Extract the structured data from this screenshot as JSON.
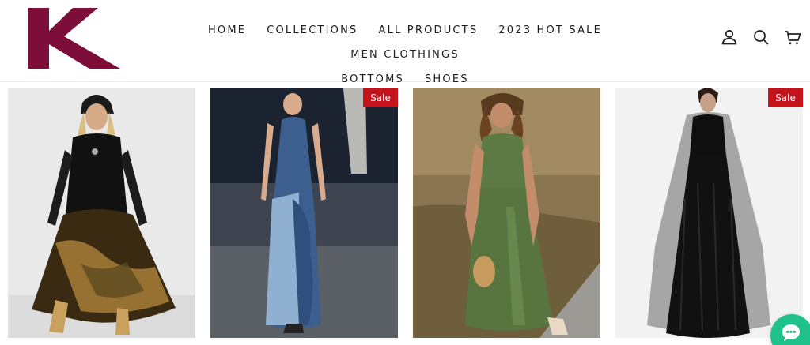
{
  "brand": {
    "logo_letter": "K",
    "logo_color": "#7d0e3a"
  },
  "nav": {
    "items": [
      {
        "label": "HOME"
      },
      {
        "label": "COLLECTIONS"
      },
      {
        "label": "ALL PRODUCTS"
      },
      {
        "label": "2023 HOT SALE"
      },
      {
        "label": "MEN CLOTHINGS"
      },
      {
        "label": "BOTTOMS"
      },
      {
        "label": "SHOES"
      }
    ]
  },
  "header_icons": [
    "account-icon",
    "search-icon",
    "cart-icon"
  ],
  "products": [
    {
      "image": "black-floral-chiffon-maxi-dress",
      "badge": ""
    },
    {
      "image": "denim-patchwork-maxi-dress",
      "badge": "Sale"
    },
    {
      "image": "olive-green-sleeveless-maxi-dress",
      "badge": ""
    },
    {
      "image": "black-cape-sleeve-gown",
      "badge": "Sale"
    }
  ],
  "colors": {
    "sale_badge": "#c3141b",
    "chat_button": "#1fc28b"
  }
}
